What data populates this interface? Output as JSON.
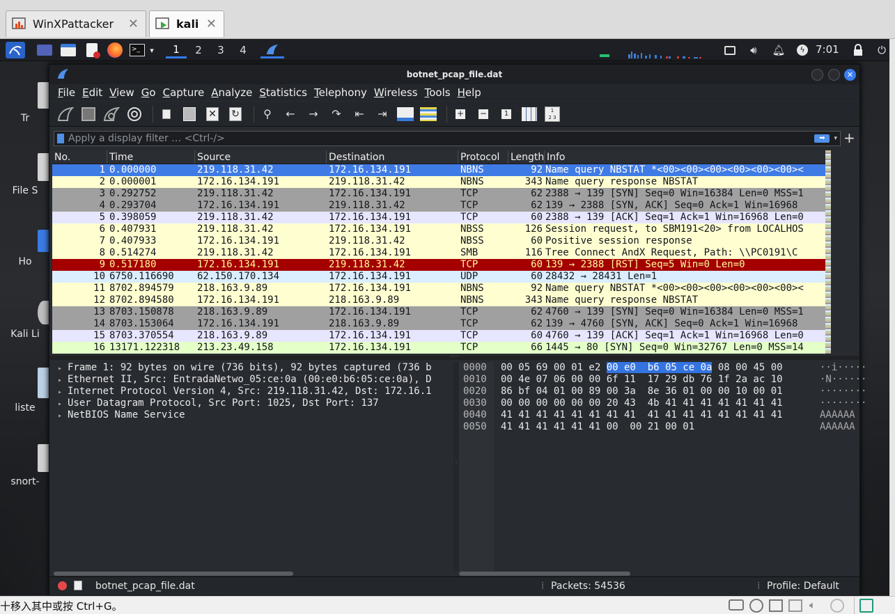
{
  "vm_tabs": [
    {
      "label": "WinXPattacker",
      "active": false
    },
    {
      "label": "kali",
      "active": true
    }
  ],
  "panel": {
    "workspaces": [
      "1",
      "2",
      "3",
      "4"
    ],
    "current_workspace": "1",
    "clock": "7:01"
  },
  "desktop_icons": [
    "Tr",
    "File S",
    "Ho",
    "Kali Li",
    "liste",
    "snort-"
  ],
  "window": {
    "title": "botnet_pcap_file.dat",
    "menu": [
      "File",
      "Edit",
      "View",
      "Go",
      "Capture",
      "Analyze",
      "Statistics",
      "Telephony",
      "Wireless",
      "Tools",
      "Help"
    ],
    "filter_placeholder": "Apply a display filter … <Ctrl-/>"
  },
  "packet_columns": [
    "No.",
    "Time",
    "Source",
    "Destination",
    "Protocol",
    "Length",
    "Info"
  ],
  "packets": [
    {
      "no": "1",
      "time": "0.000000",
      "src": "219.118.31.42",
      "dst": "172.16.134.191",
      "proto": "NBNS",
      "len": "92",
      "info": "Name query NBSTAT *<00><00><00><00><00><00><",
      "bg": "#3f7be5",
      "fg": "#ffffff"
    },
    {
      "no": "2",
      "time": "0.000001",
      "src": "172.16.134.191",
      "dst": "219.118.31.42",
      "proto": "NBNS",
      "len": "343",
      "info": "Name query response NBSTAT",
      "bg": "#fefed0",
      "fg": "#12151a"
    },
    {
      "no": "3",
      "time": "0.292752",
      "src": "219.118.31.42",
      "dst": "172.16.134.191",
      "proto": "TCP",
      "len": "62",
      "info": "2388 → 139 [SYN] Seq=0 Win=16384 Len=0 MSS=1",
      "bg": "#a0a0a0",
      "fg": "#12151a"
    },
    {
      "no": "4",
      "time": "0.293704",
      "src": "172.16.134.191",
      "dst": "219.118.31.42",
      "proto": "TCP",
      "len": "62",
      "info": "139 → 2388 [SYN, ACK] Seq=0 Ack=1 Win=16968",
      "bg": "#a0a0a0",
      "fg": "#12151a"
    },
    {
      "no": "5",
      "time": "0.398059",
      "src": "219.118.31.42",
      "dst": "172.16.134.191",
      "proto": "TCP",
      "len": "60",
      "info": "2388 → 139 [ACK] Seq=1 Ack=1 Win=16968 Len=0",
      "bg": "#e7e6ff",
      "fg": "#12151a"
    },
    {
      "no": "6",
      "time": "0.407931",
      "src": "219.118.31.42",
      "dst": "172.16.134.191",
      "proto": "NBSS",
      "len": "126",
      "info": "Session request, to SBM191<20> from LOCALHOS",
      "bg": "#fefed0",
      "fg": "#12151a"
    },
    {
      "no": "7",
      "time": "0.407933",
      "src": "172.16.134.191",
      "dst": "219.118.31.42",
      "proto": "NBSS",
      "len": "60",
      "info": "Positive session response",
      "bg": "#fefed0",
      "fg": "#12151a"
    },
    {
      "no": "8",
      "time": "0.514274",
      "src": "219.118.31.42",
      "dst": "172.16.134.191",
      "proto": "SMB",
      "len": "116",
      "info": "Tree Connect AndX Request, Path: \\\\PC0191\\C",
      "bg": "#fefed0",
      "fg": "#12151a"
    },
    {
      "no": "9",
      "time": "0.517180",
      "src": "172.16.134.191",
      "dst": "219.118.31.42",
      "proto": "TCP",
      "len": "60",
      "info": "139 → 2388 [RST] Seq=5 Win=0 Len=0",
      "bg": "#a40000",
      "fg": "#fffc9c"
    },
    {
      "no": "10",
      "time": "6750.116690",
      "src": "62.150.170.134",
      "dst": "172.16.134.191",
      "proto": "UDP",
      "len": "60",
      "info": "28432 → 28431 Len=1",
      "bg": "#daeeff",
      "fg": "#12151a"
    },
    {
      "no": "11",
      "time": "8702.894579",
      "src": "218.163.9.89",
      "dst": "172.16.134.191",
      "proto": "NBNS",
      "len": "92",
      "info": "Name query NBSTAT *<00><00><00><00><00><00><",
      "bg": "#fefed0",
      "fg": "#12151a"
    },
    {
      "no": "12",
      "time": "8702.894580",
      "src": "172.16.134.191",
      "dst": "218.163.9.89",
      "proto": "NBNS",
      "len": "343",
      "info": "Name query response NBSTAT",
      "bg": "#fefed0",
      "fg": "#12151a"
    },
    {
      "no": "13",
      "time": "8703.150878",
      "src": "218.163.9.89",
      "dst": "172.16.134.191",
      "proto": "TCP",
      "len": "62",
      "info": "4760 → 139 [SYN] Seq=0 Win=16384 Len=0 MSS=1",
      "bg": "#a0a0a0",
      "fg": "#12151a"
    },
    {
      "no": "14",
      "time": "8703.153064",
      "src": "172.16.134.191",
      "dst": "218.163.9.89",
      "proto": "TCP",
      "len": "62",
      "info": "139 → 4760 [SYN, ACK] Seq=0 Ack=1 Win=16968",
      "bg": "#a0a0a0",
      "fg": "#12151a"
    },
    {
      "no": "15",
      "time": "8703.370554",
      "src": "218.163.9.89",
      "dst": "172.16.134.191",
      "proto": "TCP",
      "len": "60",
      "info": "4760 → 139 [ACK] Seq=1 Ack=1 Win=16968 Len=0",
      "bg": "#e7e6ff",
      "fg": "#12151a"
    },
    {
      "no": "16",
      "time": "13171.122318",
      "src": "213.23.49.158",
      "dst": "172.16.134.191",
      "proto": "TCP",
      "len": "66",
      "info": "1445 → 80 [SYN] Seq=0 Win=32767 Len=0 MSS=14",
      "bg": "#e4ffc7",
      "fg": "#12151a"
    }
  ],
  "details": [
    "Frame 1: 92 bytes on wire (736 bits), 92 bytes captured (736 b",
    "Ethernet II, Src: EntradaNetwo_05:ce:0a (00:e0:b6:05:ce:0a), D",
    "Internet Protocol Version 4, Src: 219.118.31.42, Dst: 172.16.1",
    "User Datagram Protocol, Src Port: 1025, Dst Port: 137",
    "NetBIOS Name Service"
  ],
  "bytes": [
    {
      "off": "0000",
      "pre": "00 05 69 00 01 e2 ",
      "hl": "00 e0  b6 05 ce 0a",
      "post": " 08 00 45 00",
      "ascii": "··i·····"
    },
    {
      "off": "0010",
      "pre": "00 4e 07 06 00 00 6f 11  17 29 db 76 1f 2a ac 10",
      "hl": "",
      "post": "",
      "ascii": "·N······"
    },
    {
      "off": "0020",
      "pre": "86 bf 04 01 00 89 00 3a  8e 36 01 00 00 10 00 01",
      "hl": "",
      "post": "",
      "ascii": "········"
    },
    {
      "off": "0030",
      "pre": "00 00 00 00 00 00 20 43  4b 41 41 41 41 41 41 41",
      "hl": "",
      "post": "",
      "ascii": "········"
    },
    {
      "off": "0040",
      "pre": "41 41 41 41 41 41 41 41  41 41 41 41 41 41 41 41",
      "hl": "",
      "post": "",
      "ascii": "AAAAAA"
    },
    {
      "off": "0050",
      "pre": "41 41 41 41 41 41 00  00 21 00 01",
      "hl": "",
      "post": "",
      "ascii": "AAAAAA"
    }
  ],
  "status": {
    "file": "botnet_pcap_file.dat",
    "packets": "Packets: 54536",
    "profile": "Profile: Default"
  },
  "host_status": "十移入其中或按 Ctrl+G。",
  "colors": {
    "accent": "#367bf0",
    "selected": "#3474e0"
  }
}
